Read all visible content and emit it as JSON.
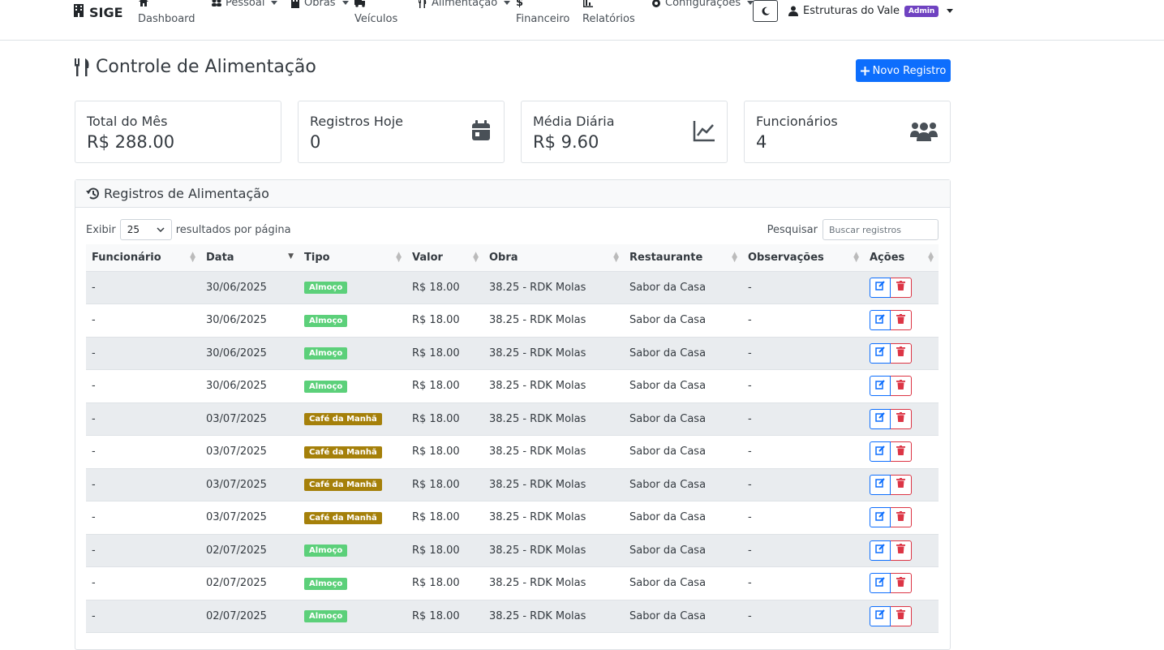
{
  "nav": {
    "brand": "SIGE",
    "dashboard": "Dashboard",
    "pessoal": "Pessoal",
    "obras": "Obras",
    "veiculos": "Veículos",
    "alimentacao": "Alimentação",
    "financeiro": "Financeiro",
    "relatorios": "Relatórios",
    "configuracoes": "Configurações",
    "user": "Estruturas do Vale",
    "user_badge": "Admin"
  },
  "header": {
    "title": "Controle de Alimentação",
    "new_button": "Novo Registro"
  },
  "stats": [
    {
      "label": "Total do Mês",
      "value": "R$ 288.00",
      "icon": "wallet-icon"
    },
    {
      "label": "Registros Hoje",
      "value": "0",
      "icon": "calendar-icon"
    },
    {
      "label": "Média Diária",
      "value": "R$ 9.60",
      "icon": "chart-line-icon"
    },
    {
      "label": "Funcionários",
      "value": "4",
      "icon": "users-icon"
    }
  ],
  "panel": {
    "title": "Registros de Alimentação",
    "show_label": "Exibir",
    "page_size": "25",
    "per_page_label": "resultados por página",
    "search_label": "Pesquisar",
    "search_placeholder": "Buscar registros"
  },
  "table": {
    "columns": [
      "Funcionário",
      "Data",
      "Tipo",
      "Valor",
      "Obra",
      "Restaurante",
      "Observações",
      "Ações"
    ],
    "rows": [
      {
        "funcionario": "-",
        "data": "30/06/2025",
        "tipo": "Almoço",
        "valor": "R$ 18.00",
        "obra": "38.25 - RDK Molas",
        "restaurante": "Sabor da Casa",
        "obs": "-"
      },
      {
        "funcionario": "-",
        "data": "30/06/2025",
        "tipo": "Almoço",
        "valor": "R$ 18.00",
        "obra": "38.25 - RDK Molas",
        "restaurante": "Sabor da Casa",
        "obs": "-"
      },
      {
        "funcionario": "-",
        "data": "30/06/2025",
        "tipo": "Almoço",
        "valor": "R$ 18.00",
        "obra": "38.25 - RDK Molas",
        "restaurante": "Sabor da Casa",
        "obs": "-"
      },
      {
        "funcionario": "-",
        "data": "30/06/2025",
        "tipo": "Almoço",
        "valor": "R$ 18.00",
        "obra": "38.25 - RDK Molas",
        "restaurante": "Sabor da Casa",
        "obs": "-"
      },
      {
        "funcionario": "-",
        "data": "03/07/2025",
        "tipo": "Café da Manhã",
        "valor": "R$ 18.00",
        "obra": "38.25 - RDK Molas",
        "restaurante": "Sabor da Casa",
        "obs": "-"
      },
      {
        "funcionario": "-",
        "data": "03/07/2025",
        "tipo": "Café da Manhã",
        "valor": "R$ 18.00",
        "obra": "38.25 - RDK Molas",
        "restaurante": "Sabor da Casa",
        "obs": "-"
      },
      {
        "funcionario": "-",
        "data": "03/07/2025",
        "tipo": "Café da Manhã",
        "valor": "R$ 18.00",
        "obra": "38.25 - RDK Molas",
        "restaurante": "Sabor da Casa",
        "obs": "-"
      },
      {
        "funcionario": "-",
        "data": "03/07/2025",
        "tipo": "Café da Manhã",
        "valor": "R$ 18.00",
        "obra": "38.25 - RDK Molas",
        "restaurante": "Sabor da Casa",
        "obs": "-"
      },
      {
        "funcionario": "-",
        "data": "02/07/2025",
        "tipo": "Almoço",
        "valor": "R$ 18.00",
        "obra": "38.25 - RDK Molas",
        "restaurante": "Sabor da Casa",
        "obs": "-"
      },
      {
        "funcionario": "-",
        "data": "02/07/2025",
        "tipo": "Almoço",
        "valor": "R$ 18.00",
        "obra": "38.25 - RDK Molas",
        "restaurante": "Sabor da Casa",
        "obs": "-"
      },
      {
        "funcionario": "-",
        "data": "02/07/2025",
        "tipo": "Almoço",
        "valor": "R$ 18.00",
        "obra": "38.25 - RDK Molas",
        "restaurante": "Sabor da Casa",
        "obs": "-"
      }
    ]
  },
  "colors": {
    "primary": "#0d6efd",
    "danger": "#dc3545",
    "badge_almoco": "#5cd07a",
    "badge_cafe": "#a5800a",
    "admin_badge": "#6f42c1"
  }
}
